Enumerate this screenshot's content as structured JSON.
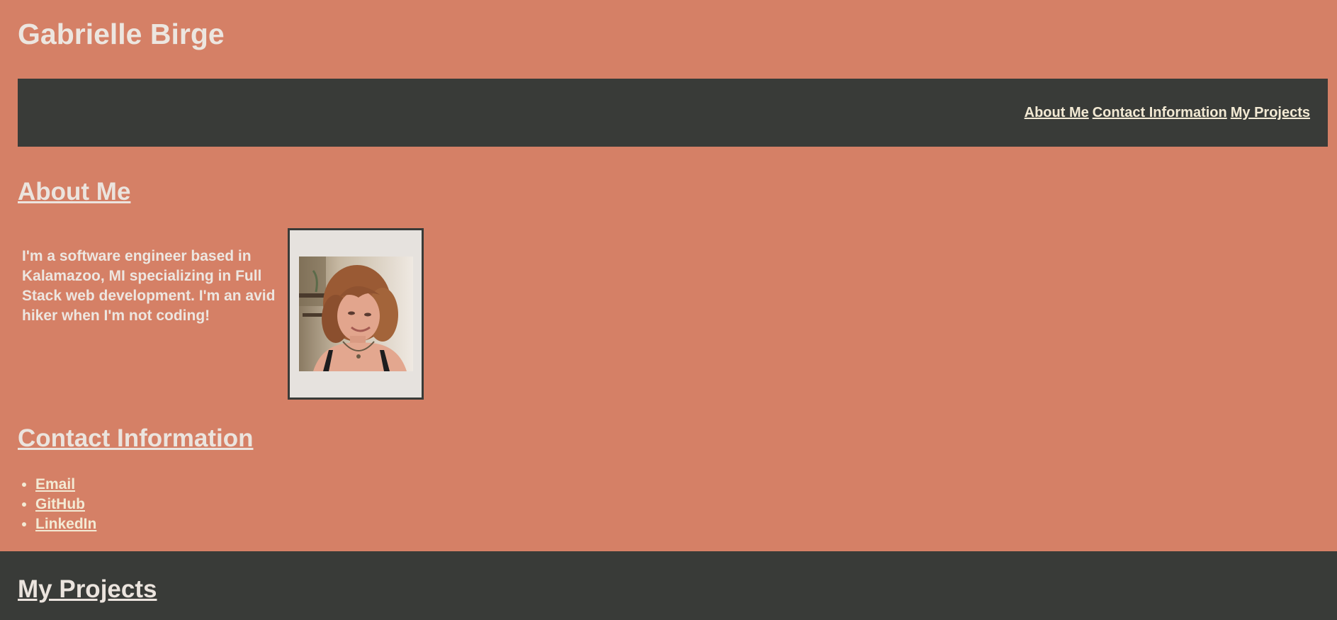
{
  "site": {
    "title": "Gabrielle Birge"
  },
  "nav": {
    "items": [
      {
        "label": "About Me"
      },
      {
        "label": "Contact Information"
      },
      {
        "label": "My Projects"
      }
    ]
  },
  "about": {
    "heading": "About Me",
    "text": "I'm a software engineer based in Kalamazoo, MI specializing in Full Stack web development. I'm an avid hiker when I'm not coding!"
  },
  "contact": {
    "heading": "Contact Information",
    "links": [
      {
        "label": "Email"
      },
      {
        "label": "GitHub"
      },
      {
        "label": "LinkedIn"
      }
    ]
  },
  "projects": {
    "heading": "My Projects"
  },
  "colors": {
    "background": "#d58066",
    "dark": "#393b38",
    "text": "#ece6e0",
    "link": "#f3ead4"
  }
}
